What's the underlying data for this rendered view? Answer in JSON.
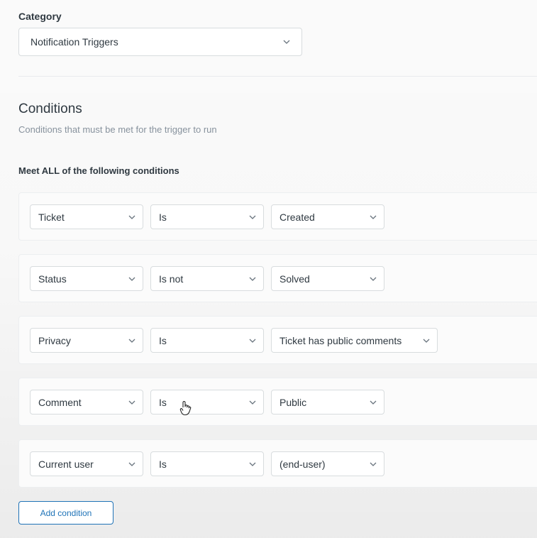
{
  "category": {
    "label": "Category",
    "selected": "Notification Triggers"
  },
  "conditions": {
    "title": "Conditions",
    "description": "Conditions that must be met for the trigger to run",
    "meet_label": "Meet ALL of the following conditions",
    "rows": [
      {
        "field": "Ticket",
        "operator": "Is",
        "value": "Created"
      },
      {
        "field": "Status",
        "operator": "Is not",
        "value": "Solved"
      },
      {
        "field": "Privacy",
        "operator": "Is",
        "value": "Ticket has public comments"
      },
      {
        "field": "Comment",
        "operator": "Is",
        "value": "Public"
      },
      {
        "field": "Current user",
        "operator": "Is",
        "value": "(end-user)"
      }
    ],
    "add_label": "Add condition"
  },
  "colors": {
    "accent": "#1f73b7",
    "text": "#2f3941",
    "muted": "#87929d",
    "border": "#d8dcde"
  },
  "icons": {
    "dropdown": "chevron-down-icon",
    "pointer": "hand-pointer-icon"
  }
}
